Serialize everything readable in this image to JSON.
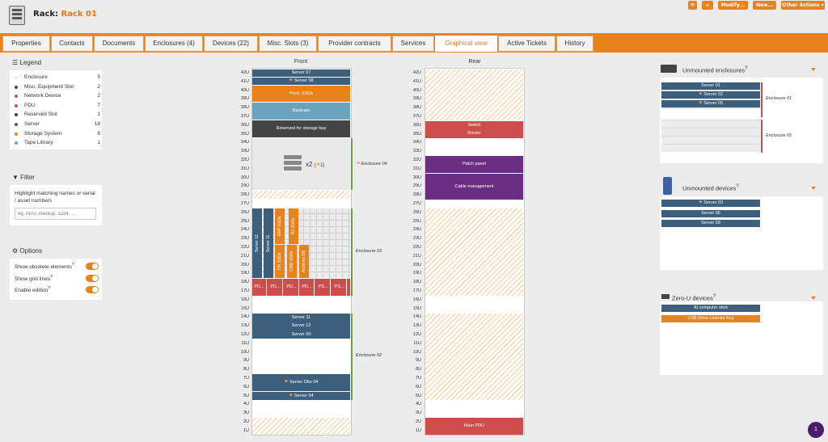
{
  "header": {
    "title_prefix": "Rack:",
    "rack_name": "Rack 01",
    "buttons": [
      "⟳",
      "🔍",
      "Modify...",
      "New...",
      "Other Actions"
    ]
  },
  "tabs": [
    "Properties",
    "Contacts",
    "Documents",
    "Enclosures (4)",
    "Devices (22)",
    "Misc. Slots (3)",
    "Provider contracts",
    "Services",
    "Graphical view",
    "Active Tickets",
    "History"
  ],
  "active_tab": "Graphical view",
  "legend": {
    "title": "Legend",
    "items": [
      {
        "label": "Enclosure",
        "count": "5",
        "color": "#e9e9e9"
      },
      {
        "label": "Misc. Equipment Slot",
        "count": "2",
        "color": "#6b2d84"
      },
      {
        "label": "Network Device",
        "count": "2",
        "color": "#cd4c4c"
      },
      {
        "label": "PDU",
        "count": "7",
        "color": "#cd4c4c"
      },
      {
        "label": "Reserved Slot",
        "count": "1",
        "color": "#444444"
      },
      {
        "label": "Server",
        "count": "18",
        "color": "#3b5f7d"
      },
      {
        "label": "Storage System",
        "count": "8",
        "color": "#e8821a"
      },
      {
        "label": "Tape Library",
        "count": "1",
        "color": "#6aa3bd"
      }
    ]
  },
  "filter": {
    "title": "Filter",
    "description": "Highlight matching names or serial / asset numbers",
    "placeholder": "eg. PDU, Backup, 1234, ..."
  },
  "options": {
    "title": "Options",
    "items": [
      "Show obsolete elements",
      "Show grid lines",
      "Enable edition"
    ]
  },
  "rack": {
    "front_label": "Front",
    "rear_label": "Rear",
    "units": [
      "42U",
      "41U",
      "40U",
      "39U",
      "38U",
      "37U",
      "36U",
      "35U",
      "34U",
      "33U",
      "32U",
      "31U",
      "30U",
      "29U",
      "28U",
      "27U",
      "26U",
      "25U",
      "24U",
      "23U",
      "22U",
      "21U",
      "20U",
      "19U",
      "18U",
      "17U",
      "16U",
      "15U",
      "14U",
      "13U",
      "12U",
      "11U",
      "10U",
      "9U",
      "8U",
      "7U",
      "6U",
      "5U",
      "4U",
      "3U",
      "2U",
      "1U"
    ],
    "front": {
      "server07": "Server 07",
      "server08": "Server 08",
      "prod_ssds": "Prod. SSDs",
      "backups": "Backups",
      "reserved": "Reserved for storage bay",
      "enc04_multiplier": "x2",
      "enc04_count": "1",
      "enc04": "Enclosure 04",
      "enc03": "Enclosure 03",
      "enc02": "Enclosure 02",
      "enc03_vertical": [
        "Server 12",
        "Server 11",
        "ERP SSDs",
        "R1 SSDs",
        "HR SSDs",
        "CRM SSDs",
        "Archives DB"
      ],
      "pdus": [
        "PD...",
        "PD...",
        "PD...",
        "PD...",
        "PS...",
        "PS..."
      ],
      "server11": "Server 11",
      "server12": "Server 12",
      "server20": "Server 20",
      "server_obs04": "Server Obs 04",
      "server04": "Server 04"
    },
    "rear": {
      "switch": "Switch",
      "router": "Router",
      "patch_panel": "Patch panel",
      "cable_mgmt": "Cable management",
      "main_pdu": "Main PDU"
    }
  },
  "unmounted_enclosures": {
    "title": "Unmounted enclosures",
    "servers": [
      "Server 01",
      "Server 02",
      "Server 05"
    ],
    "enc01": "Enclosure 01",
    "enc05": "Enclosure 05"
  },
  "unmounted_devices": {
    "title": "Unmounted devices",
    "items": [
      "Server 03",
      "Server 06",
      "Server 09"
    ]
  },
  "zero_u": {
    "title": "Zero-U devices",
    "items": [
      "AI computer stick",
      "USB Drive License Key"
    ]
  },
  "notification_count": "1"
}
